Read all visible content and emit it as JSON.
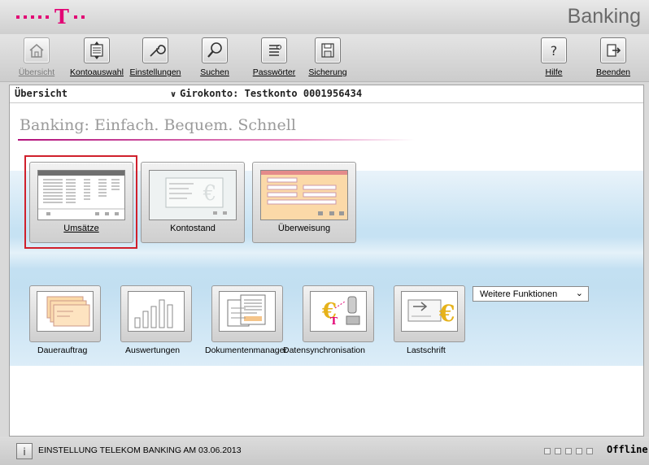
{
  "titlebar": {
    "app_title": "Banking",
    "brand_color": "#e20074"
  },
  "toolbar": {
    "items": [
      {
        "label": "Übersicht",
        "icon": "home-icon",
        "enabled": false
      },
      {
        "label": "Kontoauswahl",
        "icon": "account-select-icon",
        "enabled": true
      },
      {
        "label": "Einstellungen",
        "icon": "wrench-icon",
        "enabled": true
      },
      {
        "label": "Suchen",
        "icon": "search-icon",
        "enabled": true
      },
      {
        "label": "Passwörter",
        "icon": "password-list-icon",
        "enabled": true
      },
      {
        "label": "Sicherung",
        "icon": "backup-icon",
        "enabled": true
      },
      {
        "label": "Hilfe",
        "icon": "help-icon",
        "enabled": true
      },
      {
        "label": "Beenden",
        "icon": "exit-icon",
        "enabled": true
      }
    ]
  },
  "breadcrumb": {
    "current": "Übersicht",
    "account_label": "Girokonto: Testkonto  0001956434"
  },
  "tagline": "Banking: Einfach. Bequem. Schnell",
  "tiles": [
    {
      "label": "Umsätze",
      "selected": true
    },
    {
      "label": "Kontostand",
      "selected": false
    },
    {
      "label": "Überweisung",
      "selected": false
    }
  ],
  "functions": [
    {
      "label": "Dauerauftrag"
    },
    {
      "label": "Auswertungen"
    },
    {
      "label": "Dokumentenmanager"
    },
    {
      "label": "Datensynchronisation"
    },
    {
      "label": "Lastschrift"
    }
  ],
  "more_functions": {
    "selected": "Weitere Funktionen"
  },
  "status": {
    "message": "EINSTELLUNG TELEKOM BANKING AM 03.06.2013",
    "connection": "Offline",
    "accent": "#d0202c"
  }
}
